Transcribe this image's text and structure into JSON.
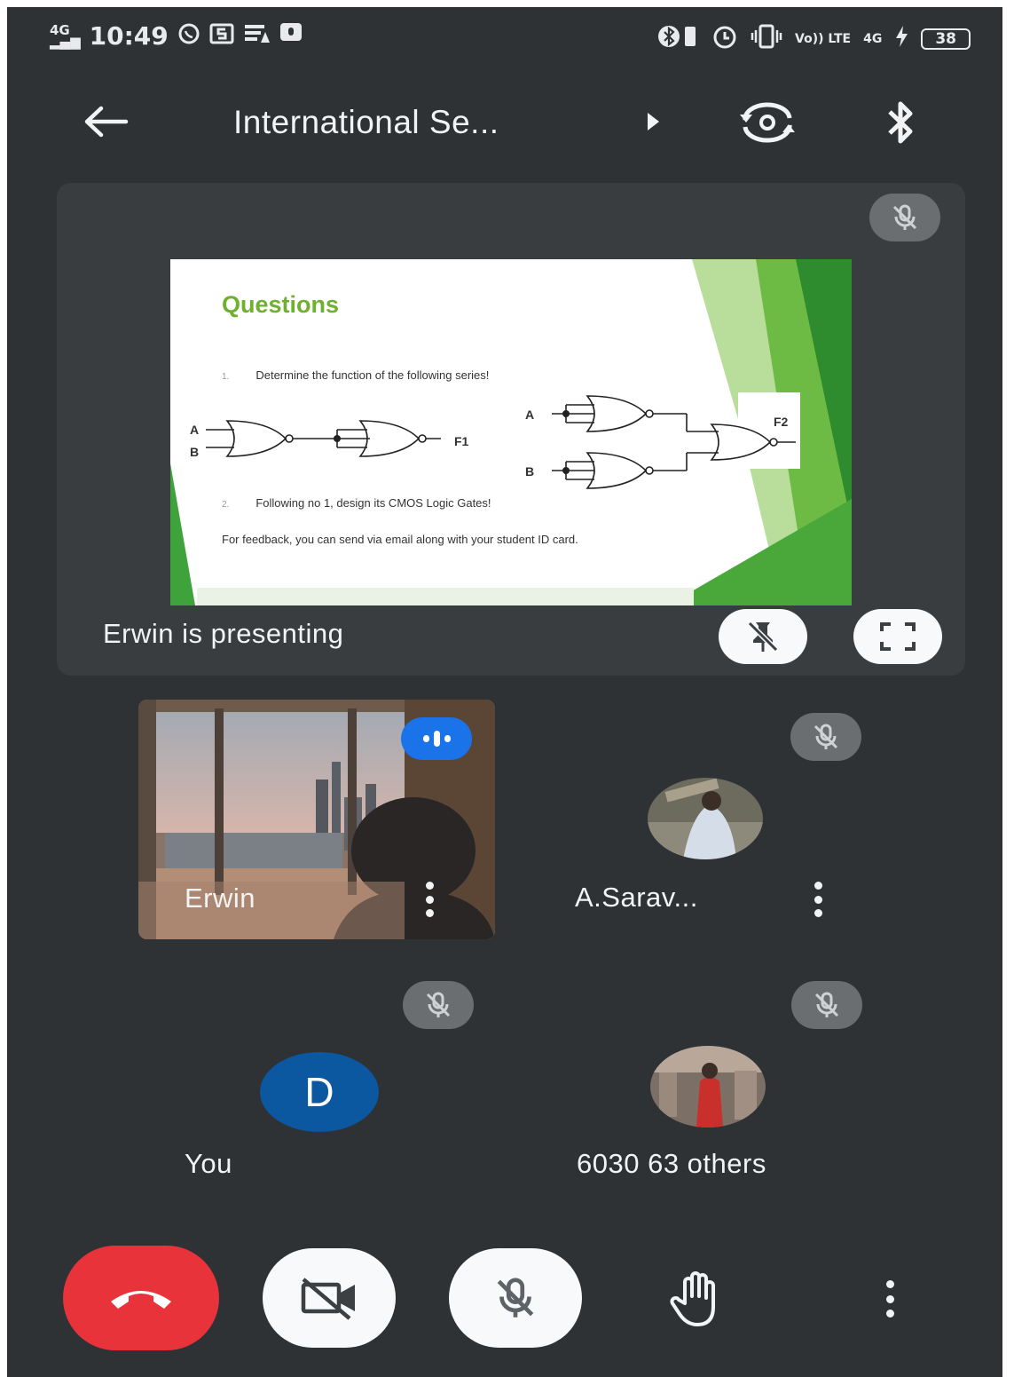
{
  "status_bar": {
    "network_left": "4G",
    "time": "10:49",
    "left_icons": [
      "whatsapp-icon",
      "s-icon",
      "wifi-data-icon",
      "message-icon"
    ],
    "right_icons": [
      "bluetooth-icon",
      "alarm-icon",
      "vibrate-icon"
    ],
    "volte": "Vo)) LTE",
    "network_right": "4G",
    "battery": "38"
  },
  "header": {
    "title": "International Se...",
    "icons": [
      "back-arrow-icon",
      "play-arrow-icon",
      "switch-camera-icon",
      "bluetooth-icon"
    ]
  },
  "presentation": {
    "slide": {
      "title": "Questions",
      "q1_num": "1.",
      "q1": "Determine the function of the following series!",
      "q2_num": "2.",
      "q2": "Following no 1, design its CMOS Logic Gates!",
      "feedback": "For feedback, you can send via email along with your student ID card.",
      "labels": {
        "a": "A",
        "b": "B",
        "f1": "F1",
        "f2": "F2"
      }
    },
    "presenting_text": "Erwin is presenting",
    "icons": [
      "mic-off-icon",
      "unpin-icon",
      "fullscreen-icon"
    ]
  },
  "participants": [
    {
      "name": "Erwin",
      "state": "speaking"
    },
    {
      "name": "A.Sarav...",
      "state": "muted"
    },
    {
      "name": "You",
      "avatar_letter": "D",
      "state": "muted"
    },
    {
      "name": "6030 63 others",
      "state": "muted"
    }
  ],
  "colors": {
    "background": "#2f3234",
    "tile": "#3a3d40",
    "accent_blue": "#1a73e8",
    "end_call": "#e8333b",
    "slide_green": "#6fb02f"
  },
  "bottom_bar": {
    "icons": [
      "end-call-icon",
      "camera-off-icon",
      "mic-off-icon",
      "raise-hand-icon",
      "more-vert-icon"
    ]
  }
}
